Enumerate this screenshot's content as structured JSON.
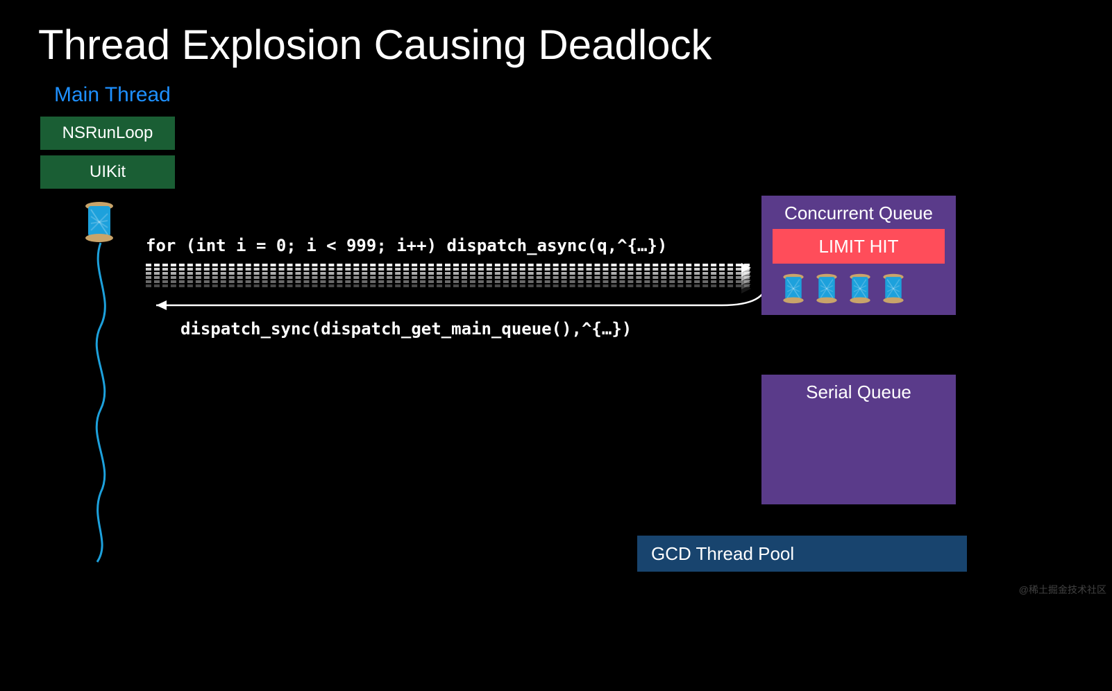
{
  "title": "Thread Explosion Causing Deadlock",
  "mainThreadLabel": "Main Thread",
  "blocks": {
    "nsrunloop": "NSRunLoop",
    "uikit": "UIKit"
  },
  "concurrentQueue": {
    "title": "Concurrent Queue",
    "limitHit": "LIMIT HIT"
  },
  "serialQueue": {
    "title": "Serial Queue"
  },
  "gcdPool": "GCD Thread Pool",
  "code": {
    "forLoop": "for (int i = 0; i < 999; i++) dispatch_async(q,^{…})",
    "dispatchSync": "dispatch_sync(dispatch_get_main_queue(),^{…})"
  },
  "watermark": "@稀土掘金技术社区",
  "spoolCount": 4,
  "dottedArrowCount": 6
}
